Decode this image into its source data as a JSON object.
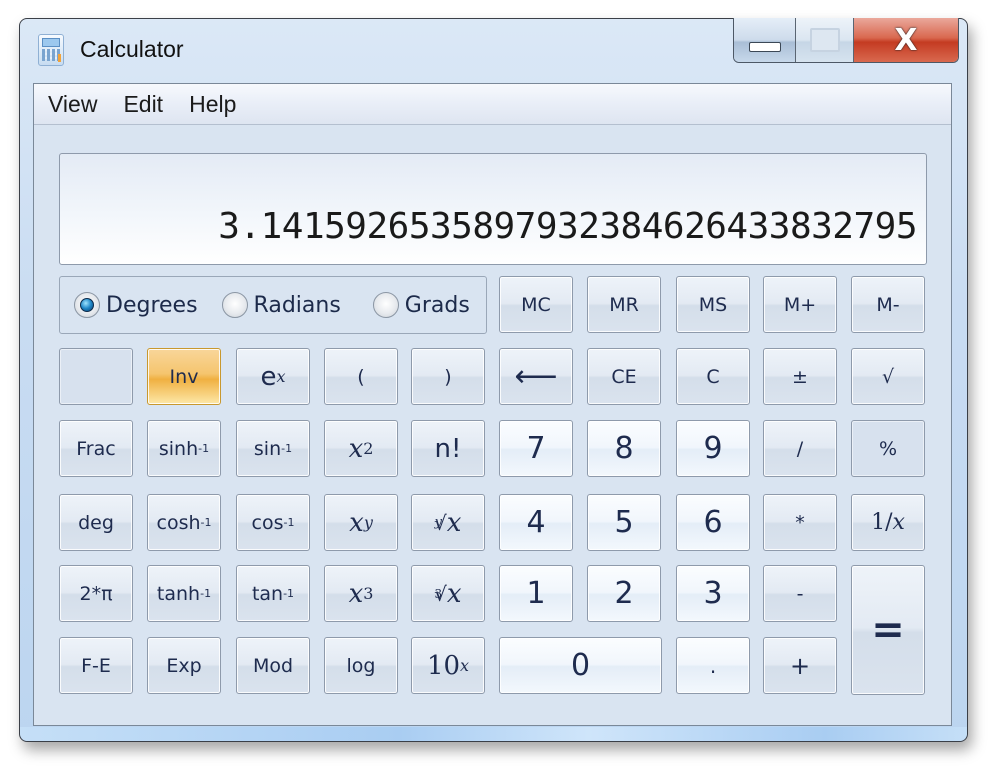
{
  "window": {
    "title": "Calculator",
    "icon": "calculator-icon",
    "controls": {
      "minimize": "minimize-icon",
      "maximize": "maximize-icon",
      "close_glyph": "X"
    }
  },
  "menu": [
    "View",
    "Edit",
    "Help"
  ],
  "display": {
    "value": "3.1415926535897932384626433832795"
  },
  "angle_mode": {
    "options": [
      "Degrees",
      "Radians",
      "Grads"
    ],
    "selected": "Degrees"
  },
  "buttons": {
    "memory": [
      "MC",
      "MR",
      "MS",
      "M+",
      "M-"
    ],
    "blank": "",
    "inv": "Inv",
    "exp_base": "e",
    "exp_sup": "x",
    "open_paren": "(",
    "close_paren": ")",
    "backspace": "⟵",
    "ce": "CE",
    "c": "C",
    "plusminus": "±",
    "sqrt": "√",
    "frac": "Frac",
    "sinh_base": "sinh",
    "sin_base": "sin",
    "inverse_sup": "-1",
    "x_base": "x",
    "sq_sup": "2",
    "fact": "n!",
    "deg": "deg",
    "cosh_base": "cosh",
    "cos_base": "cos",
    "pow_sup": "y",
    "yroot_index": "y",
    "root_glyph": "√",
    "root_x": "x",
    "two_pi": "2*π",
    "tanh_base": "tanh",
    "tan_base": "tan",
    "cube_sup": "3",
    "cuberoot_index": "3",
    "fe": "F-E",
    "expo": "Exp",
    "mod": "Mod",
    "log": "log",
    "ten_base": "10",
    "ten_sup": "x",
    "digits": [
      "0",
      "1",
      "2",
      "3",
      "4",
      "5",
      "6",
      "7",
      "8",
      "9"
    ],
    "dot": ".",
    "divide": "/",
    "multiply": "*",
    "minus": "-",
    "plus": "+",
    "percent": "%",
    "reciprocal_num": "1/",
    "reciprocal_x": "x",
    "equals": "="
  },
  "colors": {
    "inv_active": "#f5c56e",
    "radio_selected": "#1f86c7",
    "close_button": "#c43b22"
  }
}
